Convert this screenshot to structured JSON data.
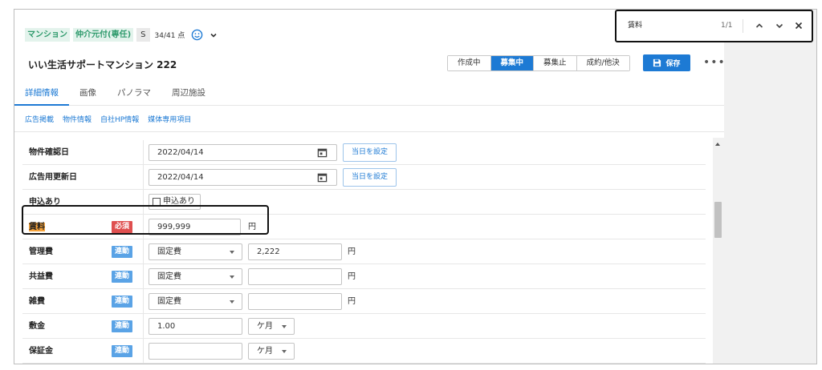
{
  "header": {
    "tags": [
      "マンション",
      "仲介元付(専任)"
    ],
    "tag_s": "S",
    "score": "34/41 点",
    "title": "いい生活サポートマンション 222"
  },
  "status_buttons": [
    {
      "label": "作成中",
      "active": false
    },
    {
      "label": "募集中",
      "active": true
    },
    {
      "label": "募集止",
      "active": false
    },
    {
      "label": "成約/他決",
      "active": false
    }
  ],
  "save_label": "保存",
  "more_label": "•••",
  "tabs": [
    "詳細情報",
    "画像",
    "パノラマ",
    "周辺施設"
  ],
  "subtabs": [
    "広告掲載",
    "物件情報",
    "自社HP情報",
    "媒体専用項目"
  ],
  "rows": {
    "r0": {
      "label": "物件確認日",
      "date": "2022/04/14",
      "today_btn": "当日を設定"
    },
    "r1": {
      "label": "広告用更新日",
      "date": "2022/04/14",
      "today_btn": "当日を設定"
    },
    "r2": {
      "label": "申込あり",
      "checkbox_label": "申込あり"
    },
    "r3": {
      "label": "賃料",
      "badge": "必須",
      "value": "999,999",
      "unit": "円"
    },
    "r4": {
      "label": "管理費",
      "badge": "連動",
      "select": "固定費",
      "value": "2,222",
      "unit": "円"
    },
    "r5": {
      "label": "共益費",
      "badge": "連動",
      "select": "固定費",
      "value": "",
      "unit": "円"
    },
    "r6": {
      "label": "雑費",
      "badge": "連動",
      "select": "固定費",
      "value": "",
      "unit": "円"
    },
    "r7": {
      "label": "敷金",
      "badge": "連動",
      "value": "1.00",
      "unit_select": "ケ月"
    },
    "r8": {
      "label": "保証金",
      "badge": "連動",
      "value": "",
      "unit_select": "ケ月"
    }
  },
  "findbar": {
    "query": "賃料",
    "count": "1/1"
  },
  "colors": {
    "accent": "#1d7ad4",
    "required": "#df4f4f",
    "linked": "#5aa3e6",
    "tag_green": "#2e9a6c",
    "highlight": "#f4a23b"
  }
}
